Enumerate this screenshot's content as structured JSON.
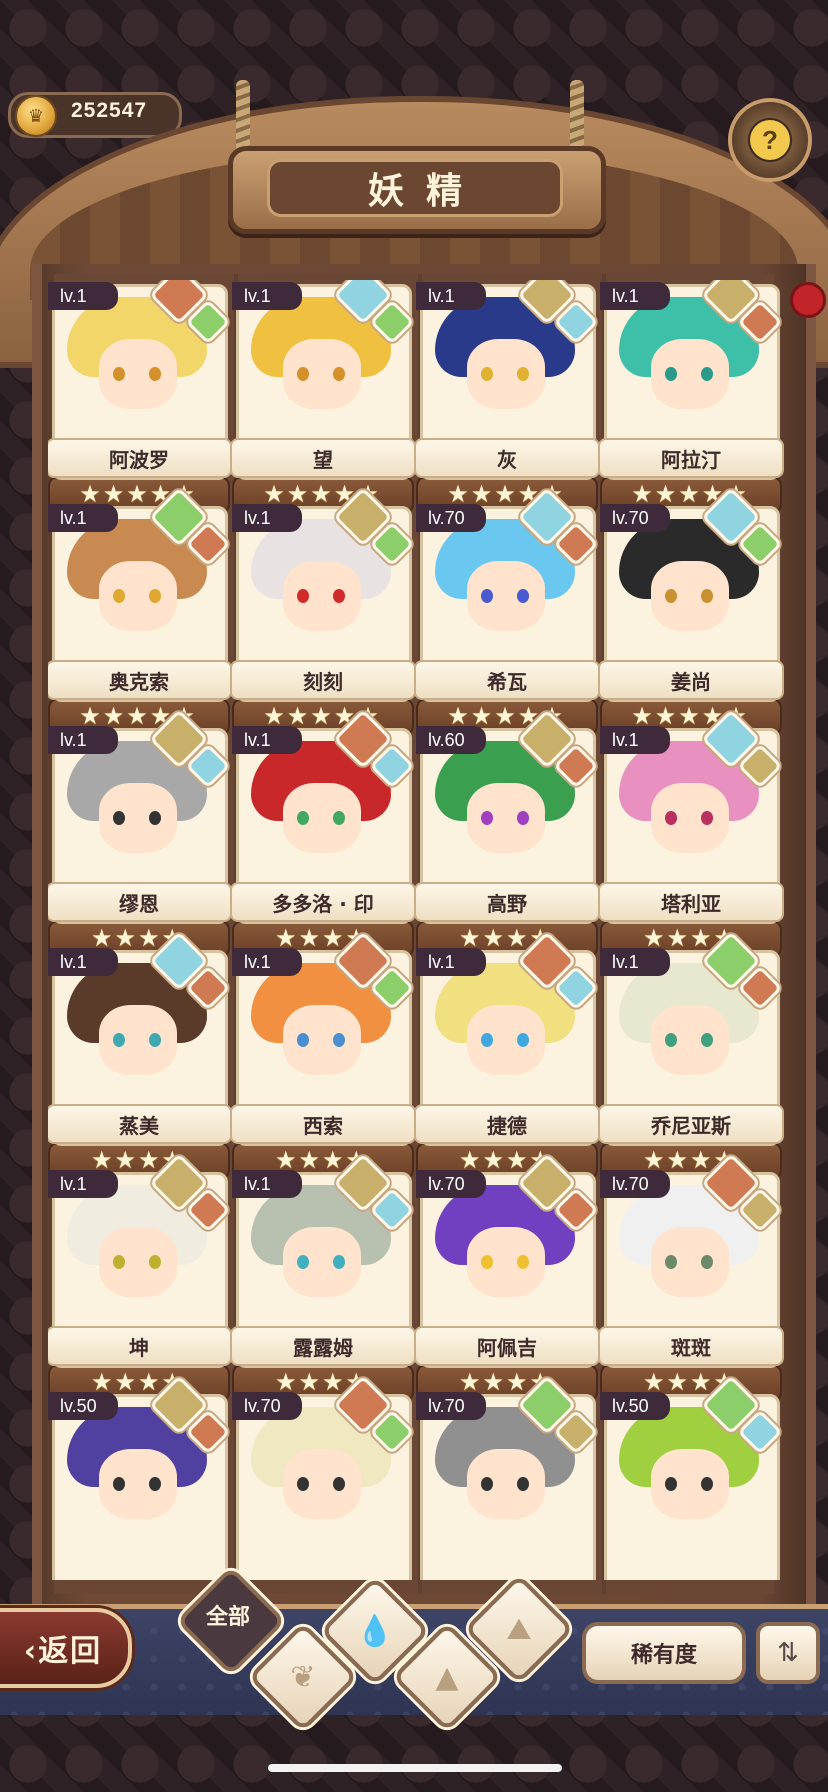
{
  "currency": {
    "value": "252547"
  },
  "header": {
    "title": "妖精"
  },
  "colors": {
    "earth": "#c8b06a",
    "water": "#8fd4e0",
    "plant": "#8ccf6a",
    "fire": "#d07a54"
  },
  "cards": [
    {
      "level": "lv.1",
      "name": "阿波罗",
      "stars": 5,
      "elements": [
        "fire",
        "plant"
      ],
      "hair": "#f2d66a",
      "eyes": "#d4902a"
    },
    {
      "level": "lv.1",
      "name": "望",
      "stars": 5,
      "elements": [
        "water",
        "plant"
      ],
      "hair": "#f0c040",
      "eyes": "#d4902a"
    },
    {
      "level": "lv.1",
      "name": "灰",
      "stars": 5,
      "elements": [
        "earth",
        "water"
      ],
      "hair": "#2a3a8a",
      "eyes": "#e0b030"
    },
    {
      "level": "lv.1",
      "name": "阿拉汀",
      "stars": 5,
      "elements": [
        "earth",
        "fire"
      ],
      "hair": "#3ec0a8",
      "eyes": "#2a9a8a"
    },
    {
      "level": "lv.1",
      "name": "奥克索",
      "stars": 5,
      "elements": [
        "plant",
        "fire"
      ],
      "hair": "#c88a50",
      "eyes": "#e0a830"
    },
    {
      "level": "lv.1",
      "name": "刻刻",
      "stars": 5,
      "elements": [
        "earth",
        "plant"
      ],
      "hair": "#e8e2e2",
      "eyes": "#d02a2a"
    },
    {
      "level": "lv.70",
      "name": "希瓦",
      "stars": 5,
      "elements": [
        "water",
        "fire"
      ],
      "hair": "#6ac8f0",
      "eyes": "#4a5ad0"
    },
    {
      "level": "lv.70",
      "name": "姜尚",
      "stars": 5,
      "elements": [
        "water",
        "plant"
      ],
      "hair": "#2a2a2a",
      "eyes": "#c89030"
    },
    {
      "level": "lv.1",
      "name": "缪恩",
      "stars": 4,
      "elements": [
        "earth",
        "water"
      ],
      "hair": "#a8a8a8",
      "eyes": "#333333"
    },
    {
      "level": "lv.1",
      "name": "多多洛 · 印",
      "stars": 4,
      "elements": [
        "fire",
        "water"
      ],
      "hair": "#c8282a",
      "eyes": "#40a860"
    },
    {
      "level": "lv.60",
      "name": "高野",
      "stars": 4,
      "elements": [
        "earth",
        "fire"
      ],
      "hair": "#3aa050",
      "eyes": "#a040c0"
    },
    {
      "level": "lv.1",
      "name": "塔利亚",
      "stars": 4,
      "elements": [
        "water",
        "earth"
      ],
      "hair": "#e890c0",
      "eyes": "#b83060"
    },
    {
      "level": "lv.1",
      "name": "蒸美",
      "stars": 4,
      "elements": [
        "water",
        "fire"
      ],
      "hair": "#5a3a28",
      "eyes": "#40a8b0"
    },
    {
      "level": "lv.1",
      "name": "西索",
      "stars": 4,
      "elements": [
        "fire",
        "plant"
      ],
      "hair": "#f09040",
      "eyes": "#4a90d0"
    },
    {
      "level": "lv.1",
      "name": "捷德",
      "stars": 4,
      "elements": [
        "fire",
        "water"
      ],
      "hair": "#f0e080",
      "eyes": "#40a8e0"
    },
    {
      "level": "lv.1",
      "name": "乔尼亚斯",
      "stars": 4,
      "elements": [
        "plant",
        "fire"
      ],
      "hair": "#e8e8d0",
      "eyes": "#40a080"
    },
    {
      "level": "lv.1",
      "name": "坤",
      "stars": 4,
      "elements": [
        "earth",
        "fire"
      ],
      "hair": "#f0ece0",
      "eyes": "#c0b030"
    },
    {
      "level": "lv.1",
      "name": "露露姆",
      "stars": 4,
      "elements": [
        "earth",
        "water"
      ],
      "hair": "#b8c0b0",
      "eyes": "#40b0c0"
    },
    {
      "level": "lv.70",
      "name": "阿佩吉",
      "stars": 4,
      "elements": [
        "earth",
        "fire"
      ],
      "hair": "#7040c0",
      "eyes": "#f0c030"
    },
    {
      "level": "lv.70",
      "name": "斑斑",
      "stars": 4,
      "elements": [
        "fire",
        "earth"
      ],
      "hair": "#f0f0f0",
      "eyes": "#6a8a6a"
    },
    {
      "level": "lv.50",
      "name": "",
      "stars": 0,
      "elements": [
        "earth",
        "fire"
      ],
      "hair": "#5040a0",
      "eyes": "#333333"
    },
    {
      "level": "lv.70",
      "name": "",
      "stars": 0,
      "elements": [
        "fire",
        "plant"
      ],
      "hair": "#f0e8c0",
      "eyes": "#333333"
    },
    {
      "level": "lv.70",
      "name": "",
      "stars": 0,
      "elements": [
        "plant",
        "earth"
      ],
      "hair": "#909090",
      "eyes": "#333333"
    },
    {
      "level": "lv.50",
      "name": "",
      "stars": 0,
      "elements": [
        "plant",
        "water"
      ],
      "hair": "#a0d040",
      "eyes": "#333333"
    }
  ],
  "bottom": {
    "back_label": "返回",
    "filter_all": "全部",
    "rarity_label": "稀有度"
  }
}
